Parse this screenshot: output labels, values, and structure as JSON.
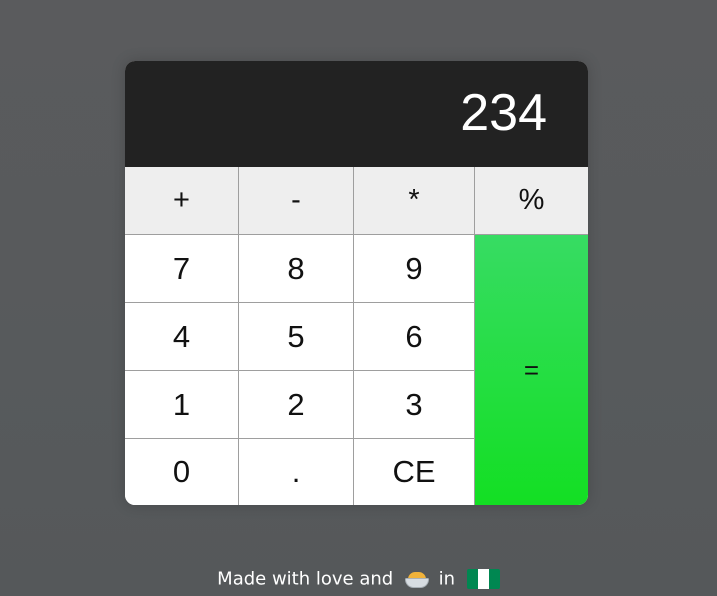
{
  "display": {
    "value": "234"
  },
  "keys": {
    "plus": "+",
    "minus": "-",
    "multiply": "*",
    "percent": "%",
    "seven": "7",
    "eight": "8",
    "nine": "9",
    "four": "4",
    "five": "5",
    "six": "6",
    "one": "1",
    "two": "2",
    "three": "3",
    "zero": "0",
    "dot": ".",
    "clear": "CE",
    "equals": "="
  },
  "footer": {
    "text_before": "Made with love and",
    "food_icon": "curry-bowl-icon",
    "text_in": "in",
    "flag_icon": "nigeria-flag-icon"
  },
  "colors": {
    "display_bg": "#222222",
    "operator_bg": "#eeeeee",
    "equals_green": "#13df23"
  }
}
